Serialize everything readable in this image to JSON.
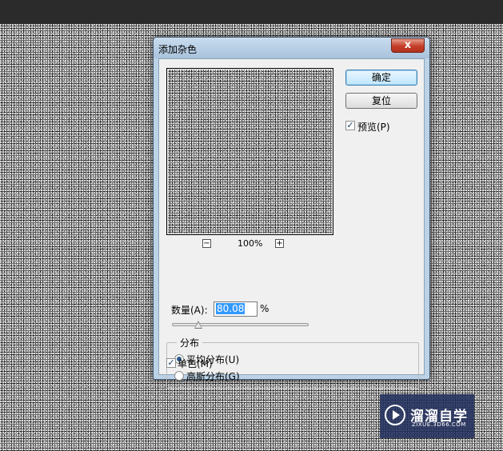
{
  "dialog": {
    "title": "添加杂色",
    "close_glyph": "x"
  },
  "buttons": {
    "ok_label": "确定",
    "reset_label": "复位"
  },
  "preview_toggle": {
    "label": "预览(P)",
    "checked": true
  },
  "zoom": {
    "minus": "−",
    "plus": "+",
    "level": "100%"
  },
  "amount": {
    "label": "数量(A):",
    "value": "80.08",
    "unit": "%"
  },
  "distribution": {
    "title": "分布",
    "options": [
      {
        "label": "平均分布(U)",
        "selected": true
      },
      {
        "label": "高斯分布(G)",
        "selected": false
      }
    ]
  },
  "monochrome": {
    "label": "单色(M)",
    "checked": true
  },
  "watermark": {
    "main": "溜溜自学",
    "sub": "ZIXUE.3D66.COM"
  },
  "colors": {
    "titlebar": "#b9d1ea",
    "close": "#c7402b",
    "selection": "#3399ff"
  }
}
